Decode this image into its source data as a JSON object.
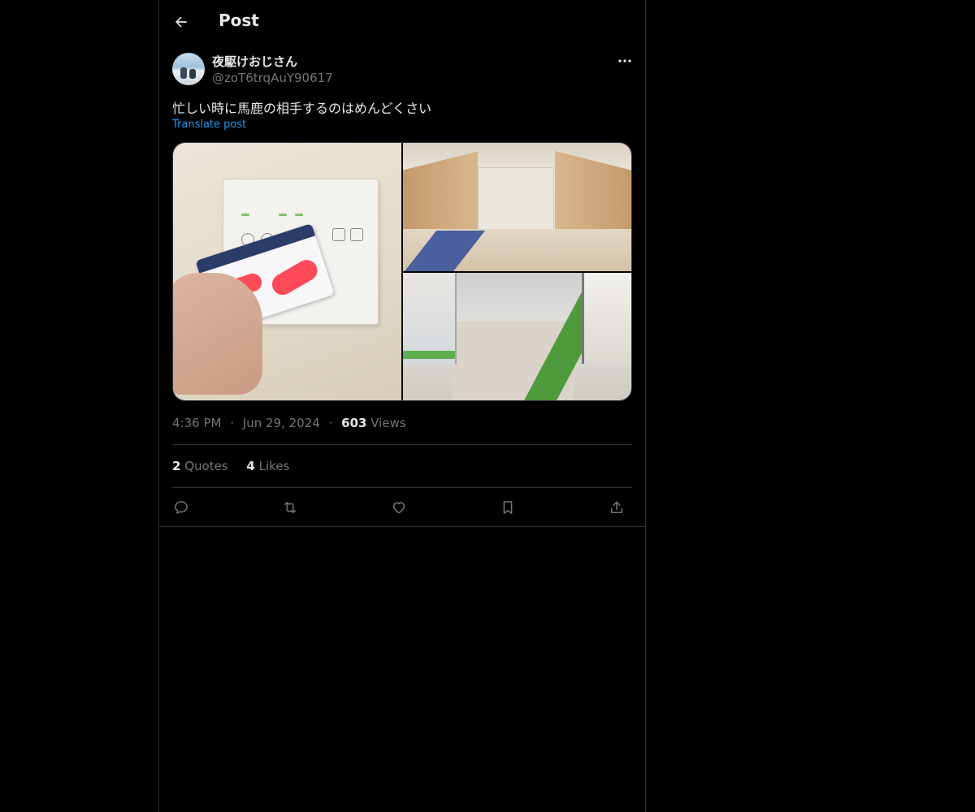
{
  "header": {
    "title": "Post",
    "back_icon": "arrow-left-icon"
  },
  "post": {
    "author": {
      "display_name": "夜駆けおじさん",
      "handle": "@zoT6trqAuY90617"
    },
    "more_icon": "ellipsis-icon",
    "text": "忙しい時に馬鹿の相手するのはめんどくさい",
    "translate_label": "Translate post",
    "media_count": 3,
    "meta": {
      "time": "4:36 PM",
      "separator": "·",
      "date": "Jun 29, 2024",
      "views_count": "603",
      "views_label": "Views"
    },
    "stats": {
      "quotes_count": "2",
      "quotes_label": "Quotes",
      "likes_count": "4",
      "likes_label": "Likes"
    },
    "actions": [
      "reply-icon",
      "repost-icon",
      "like-icon",
      "bookmark-icon",
      "share-icon"
    ]
  },
  "colors": {
    "background": "#000000",
    "text_primary": "#e7e9ea",
    "text_secondary": "#71767b",
    "link": "#1d9bf0",
    "border": "#2f3336"
  }
}
